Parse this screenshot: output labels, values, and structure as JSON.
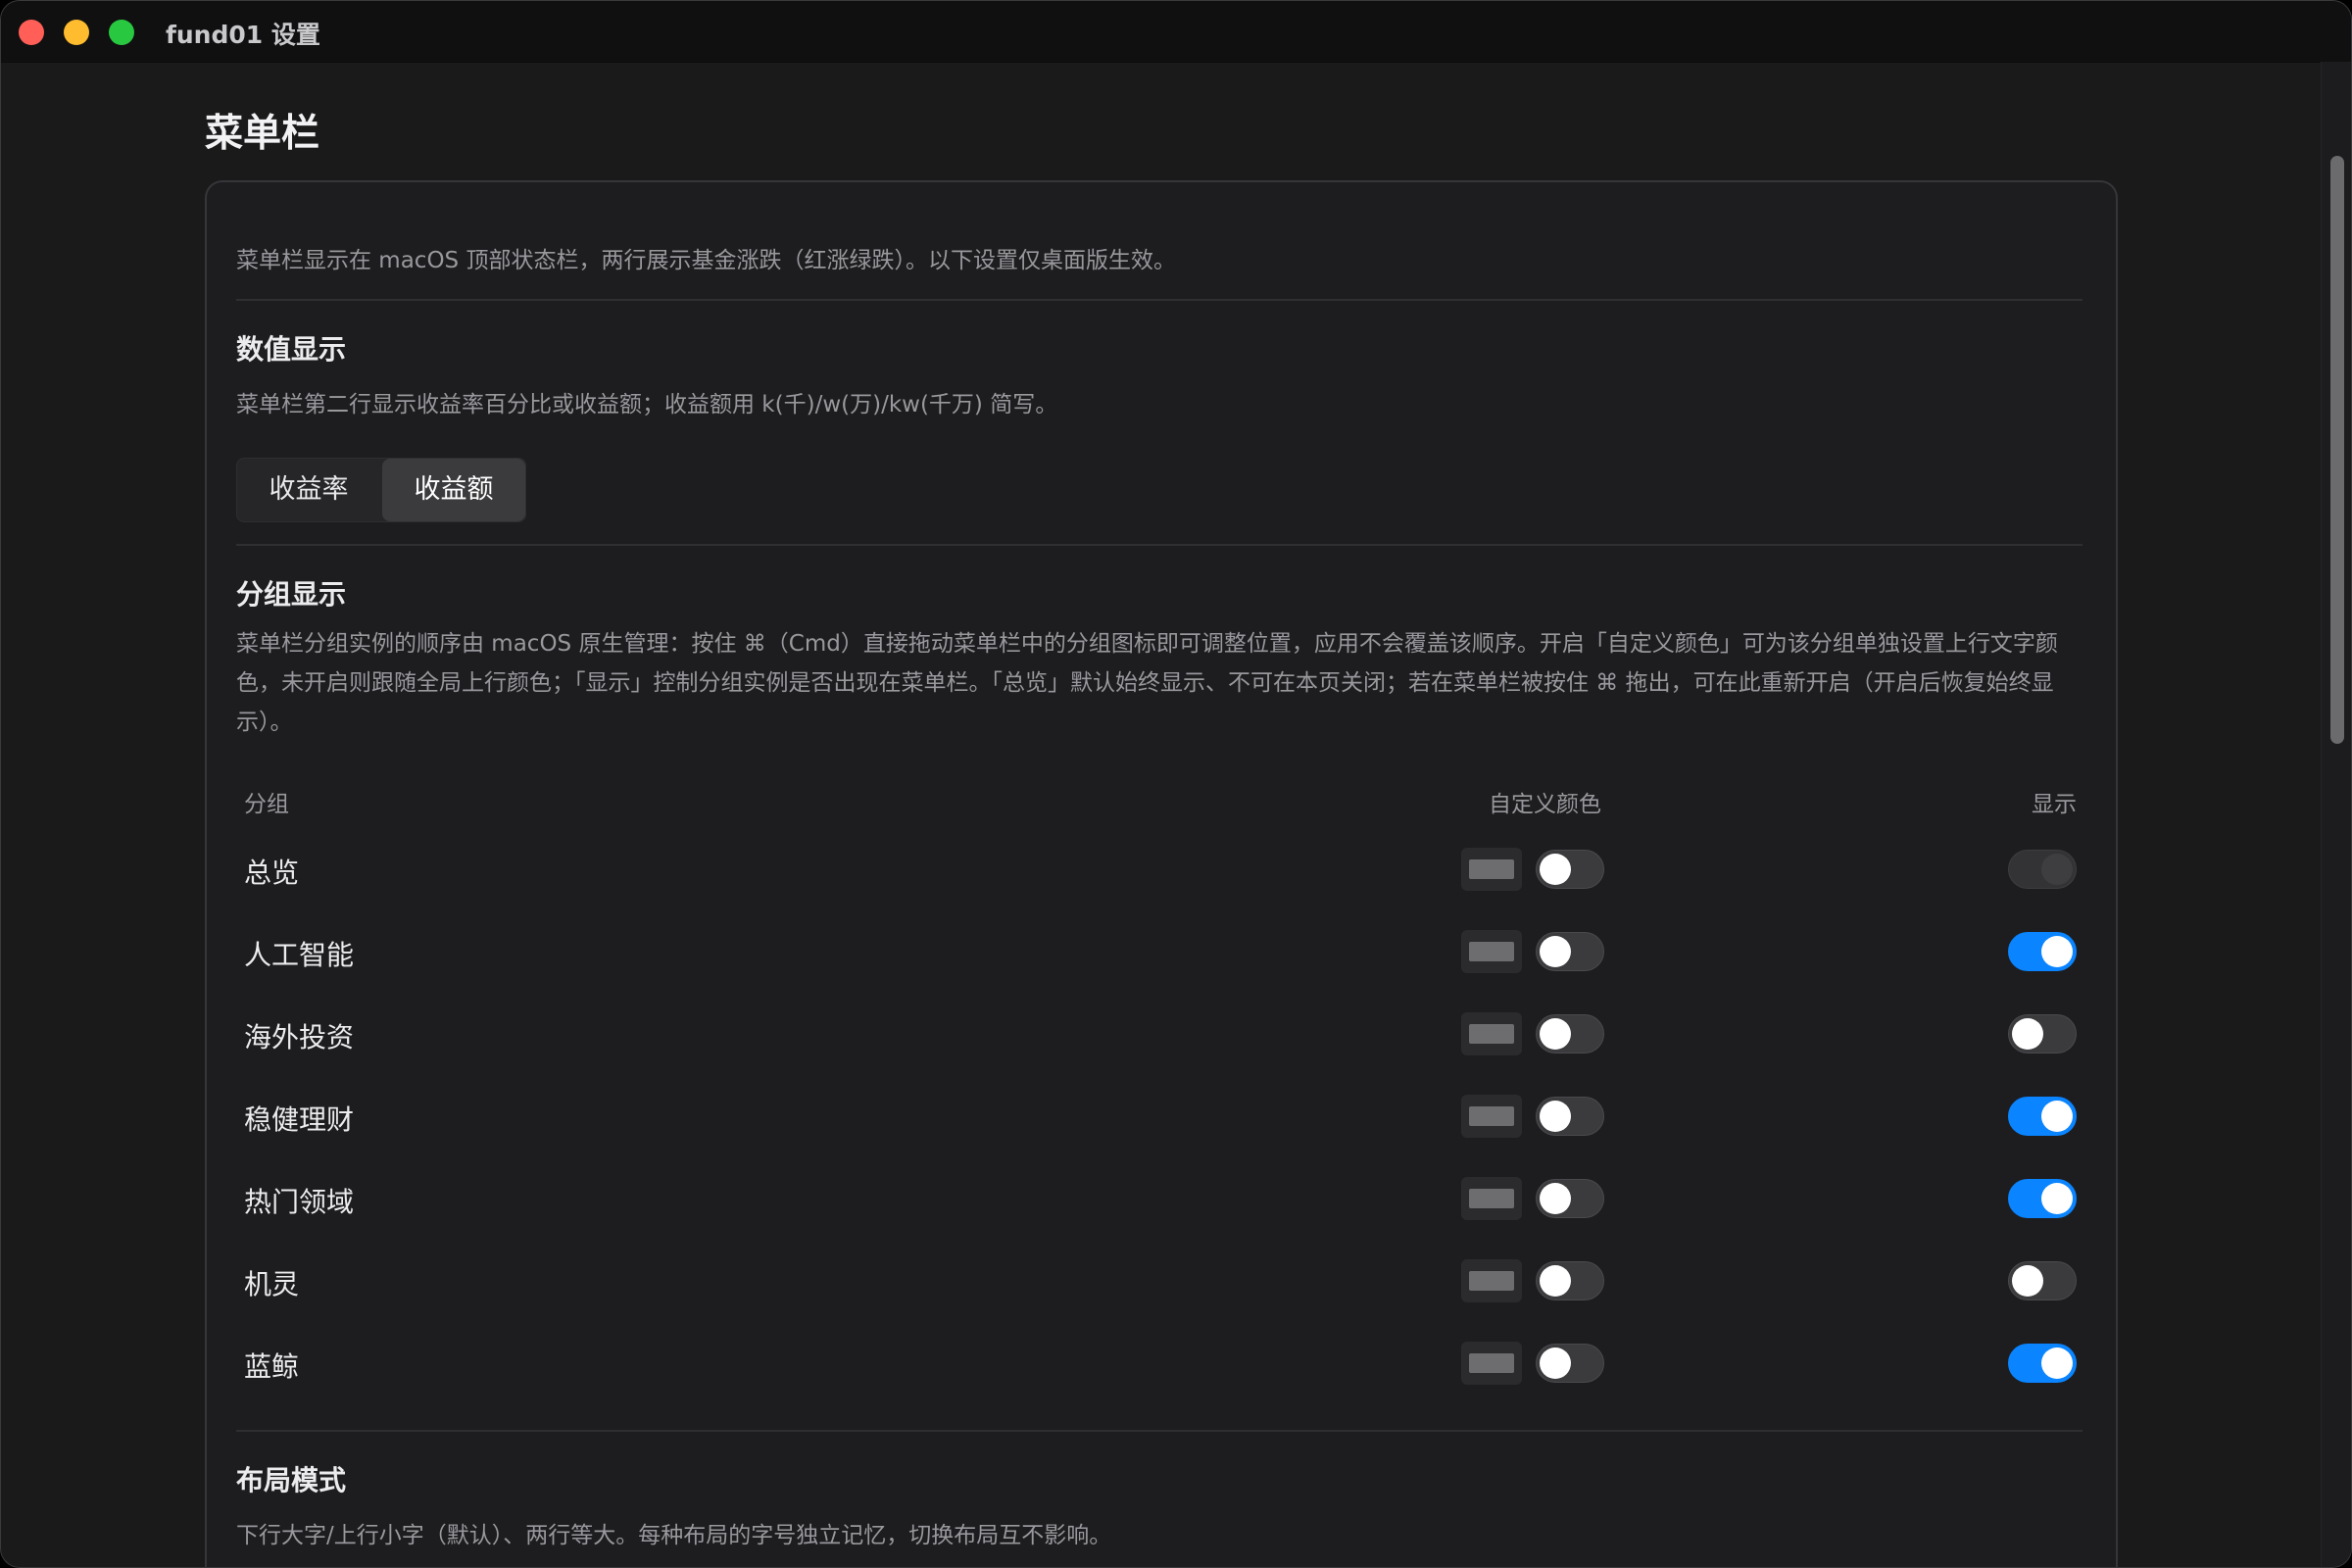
{
  "window": {
    "title": "fund01 设置"
  },
  "page": {
    "title": "菜单栏"
  },
  "card": {
    "intro": "菜单栏显示在 macOS 顶部状态栏，两行展示基金涨跌（红涨绿跌）。以下设置仅桌面版生效。",
    "value_display": {
      "title": "数值显示",
      "desc": "菜单栏第二行显示收益率百分比或收益额；收益额用 k(千)/w(万)/kw(千万) 简写。",
      "options": [
        "收益率",
        "收益额"
      ],
      "selected": "收益额"
    },
    "group_display": {
      "title": "分组显示",
      "desc": "菜单栏分组实例的顺序由 macOS 原生管理：按住 ⌘（Cmd）直接拖动菜单栏中的分组图标即可调整位置，应用不会覆盖该顺序。开启「自定义颜色」可为该分组单独设置上行文字颜色，未开启则跟随全局上行颜色；「显示」控制分组实例是否出现在菜单栏。「总览」默认始终显示、不可在本页关闭；若在菜单栏被按住 ⌘ 拖出，可在此重新开启（开启后恢复始终显示）。",
      "columns": {
        "group": "分组",
        "custom_color": "自定义颜色",
        "show": "显示"
      },
      "rows": [
        {
          "name": "总览",
          "custom_color": false,
          "show": true,
          "show_disabled": true
        },
        {
          "name": "人工智能",
          "custom_color": false,
          "show": true
        },
        {
          "name": "海外投资",
          "custom_color": false,
          "show": false
        },
        {
          "name": "稳健理财",
          "custom_color": false,
          "show": true
        },
        {
          "name": "热门领域",
          "custom_color": false,
          "show": true
        },
        {
          "name": "机灵",
          "custom_color": false,
          "show": false
        },
        {
          "name": "蓝鲸",
          "custom_color": false,
          "show": true
        }
      ]
    },
    "layout_mode": {
      "title": "布局模式",
      "desc": "下行大字/上行小字（默认）、两行等大。每种布局的字号独立记忆，切换布局互不影响。"
    }
  },
  "colors": {
    "accent": "#0a84ff",
    "swatch": "#6d6d70"
  }
}
